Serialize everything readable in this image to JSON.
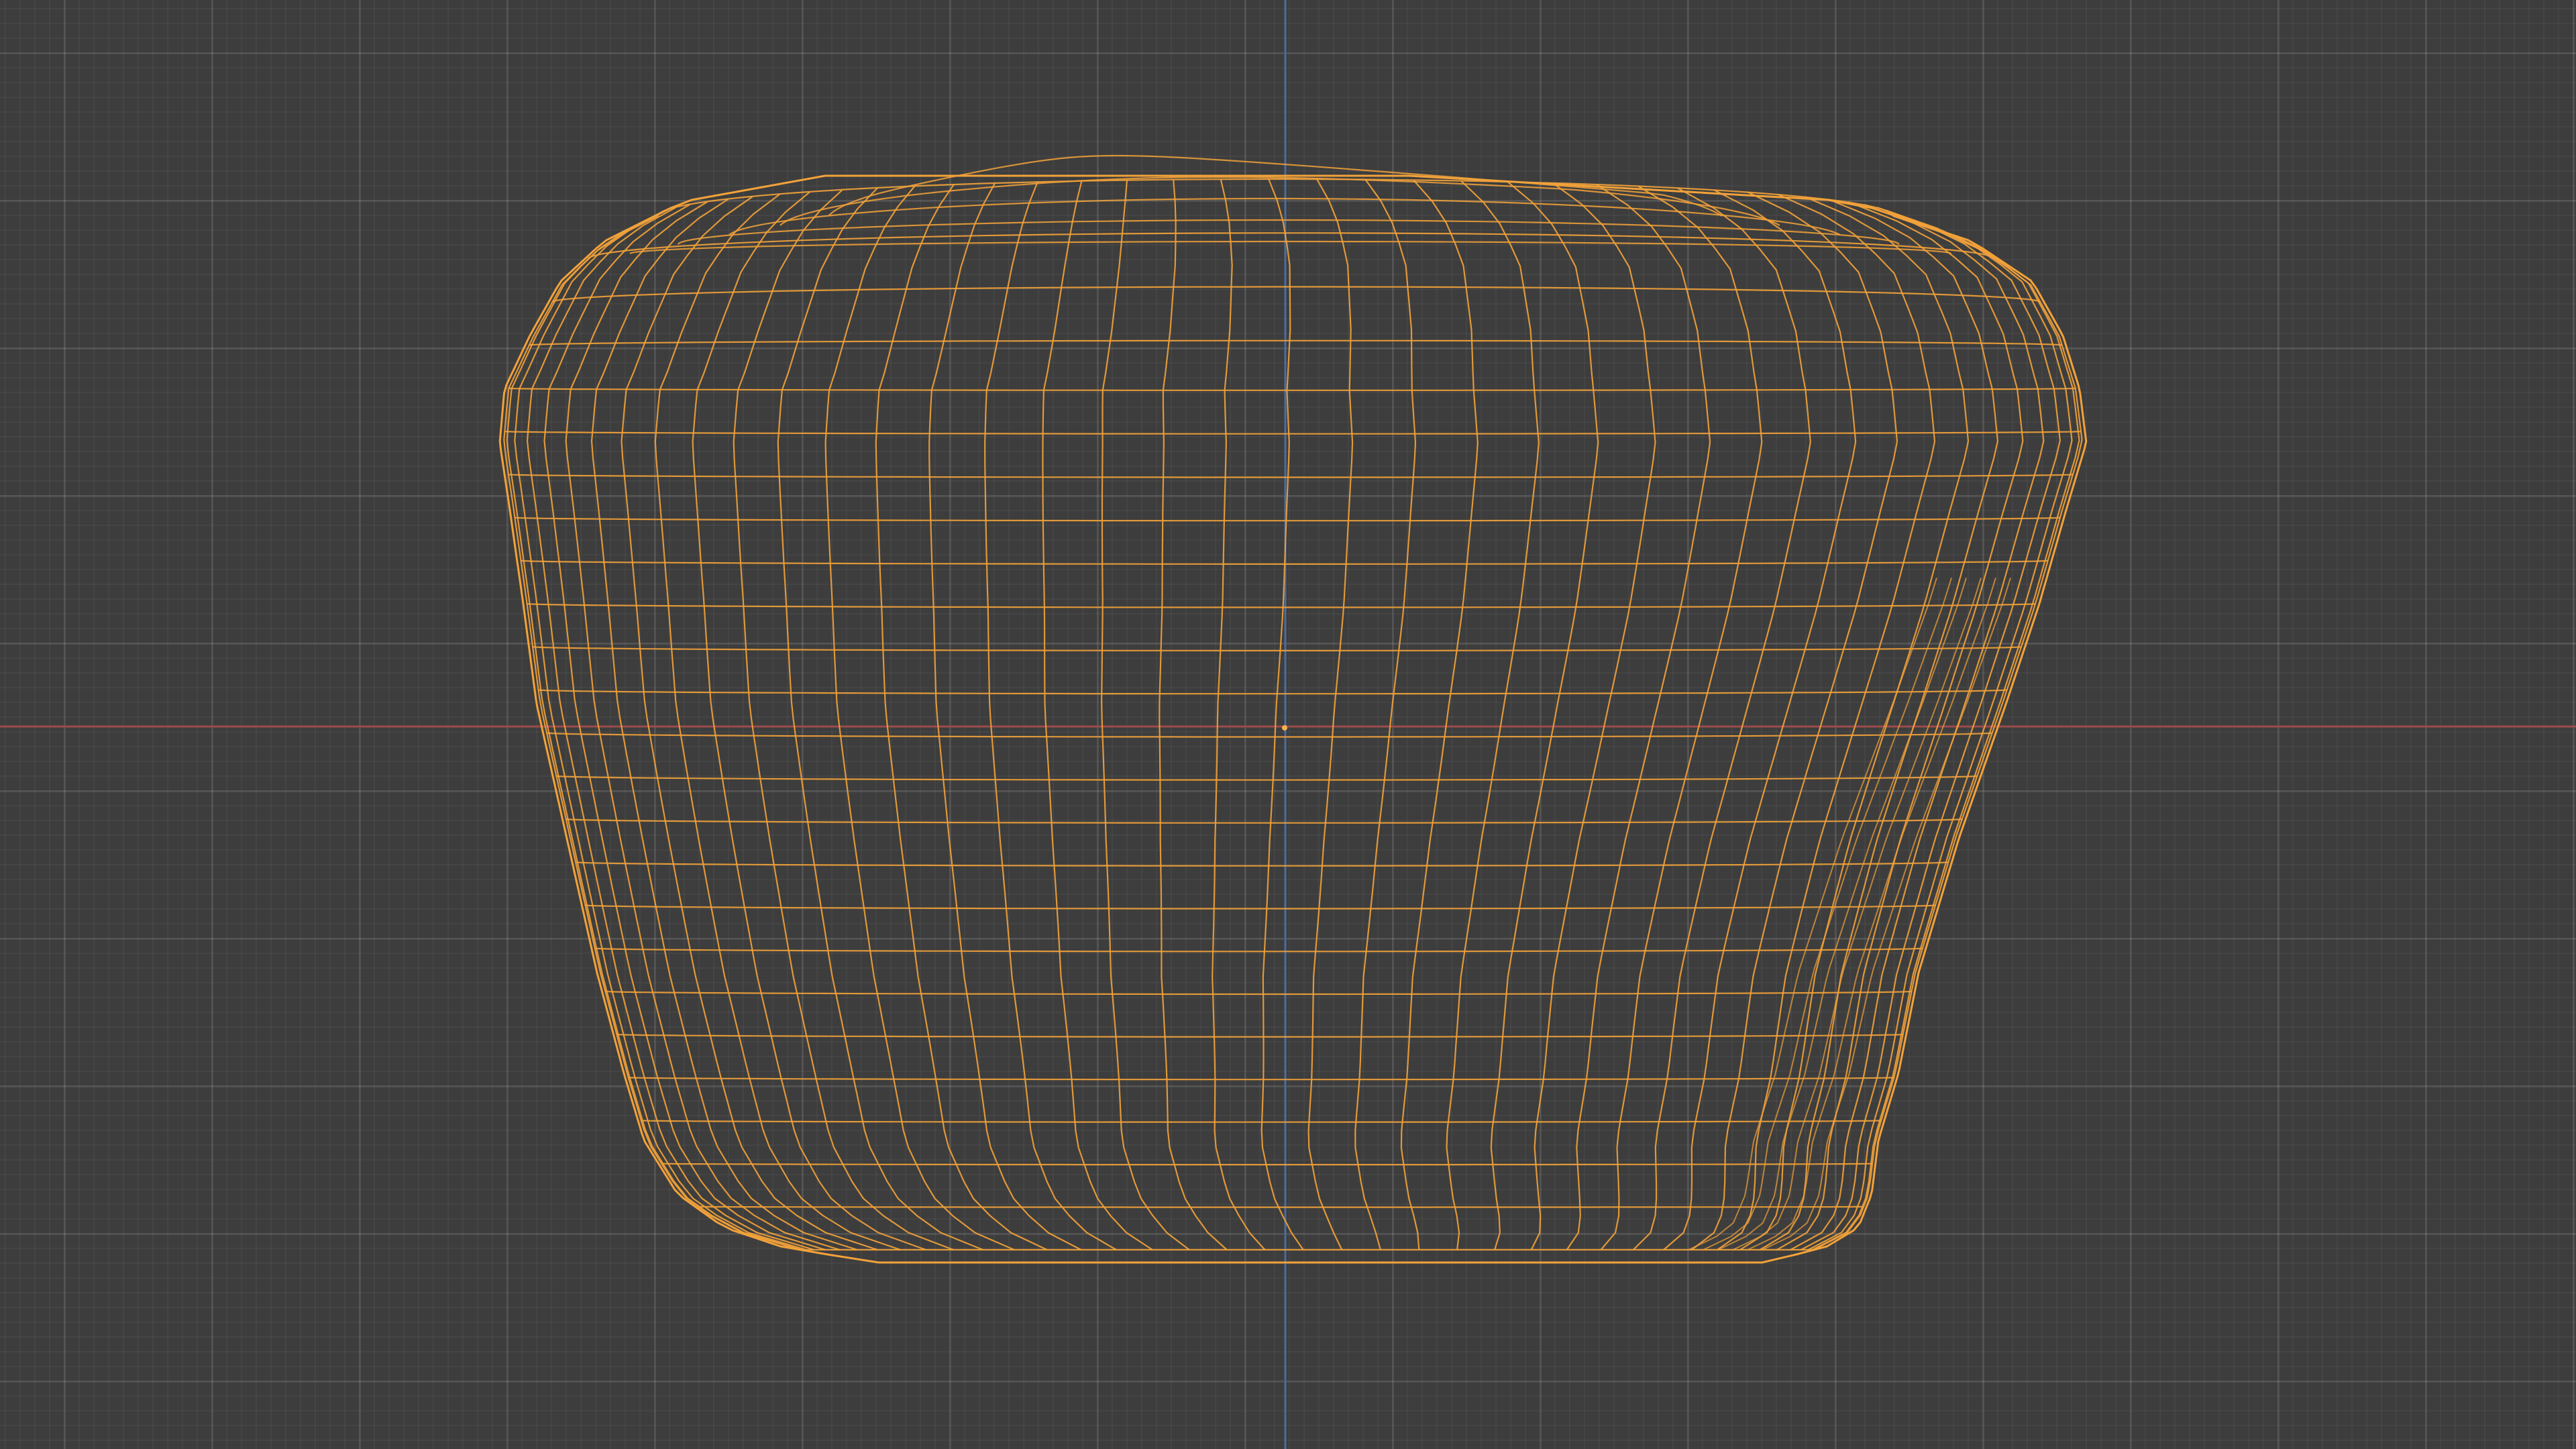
{
  "viewport": {
    "background_color": "#3d3d3d",
    "grid_color": "#4a4a4a",
    "x_axis_color": "#9b4b4b",
    "y_axis_color": "#4a6da0",
    "wire_color": "#f2a23a",
    "origin_color": "#f7b24a"
  },
  "mesh": {
    "object": "cushion-wireframe",
    "state": "selected",
    "display": "wireframe",
    "meridians": 40,
    "parallels": 24
  },
  "icons": {
    "origin": "object-origin-icon"
  }
}
